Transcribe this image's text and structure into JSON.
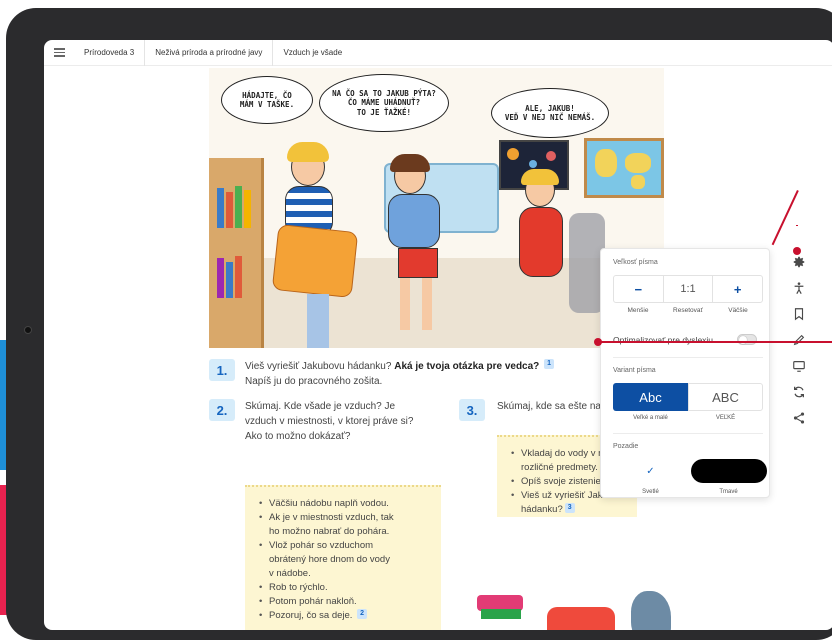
{
  "topbar": {
    "breadcrumbs": [
      "Prírodoveda 3",
      "Neživá príroda a prírodné javy",
      "Vzduch je všade"
    ]
  },
  "illustration": {
    "bubble_1": "HÁDAJTE, ČO\nMÁM V TAŠKE.",
    "bubble_2": "NA ČO SA TO JAKUB PÝTA?\nČO MÁME UHÁDNUŤ?\nTO JE ŤAŽKÉ!",
    "bubble_3": "ALE, JAKUB!\nVEĎ V NEJ NIČ NEMÁŠ."
  },
  "tasks": {
    "t1": {
      "number": "1.",
      "text": "Vieš vyriešiť Jakubovu hádanku?",
      "bold": "Aká je tvoja otázka pre vedca?",
      "ref": "1",
      "line2": "Napíš ju do pracovného zošita."
    },
    "t2": {
      "number": "2.",
      "line1": "Skúmaj. Kde všade je vzduch? Je",
      "line2": "vzduch v miestnosti, v ktorej práve si?",
      "line3": "Ako to možno dokázať?",
      "bullets": [
        "Väčšiu nádobu naplň vodou.",
        "Ak je v miestnosti vzduch, tak",
        "ho možno nabrať do pohára.",
        "Vlož pohár so vzduchom",
        "obrátený hore dnom do vody",
        "v nádobe.",
        "Rob to rýchlo.",
        "Potom pohár nakloň.",
        "Pozoruj, čo sa deje."
      ],
      "ref": "2"
    },
    "t3": {
      "number": "3.",
      "line1": "Skúmaj, kde sa ešte nachá",
      "bullets": [
        "Vkladaj do vody v nád",
        "rozličné predmety.",
        "Opíš svoje zistenie.",
        "Vieš už vyriešiť Jakub",
        "hádanku?"
      ],
      "ref": "3"
    }
  },
  "panel": {
    "size_label": "Veľkosť písma",
    "minus": "−",
    "reset": "1:1",
    "plus": "+",
    "minus_sub": "Menšie",
    "reset_sub": "Resetovať",
    "plus_sub": "Väčšie",
    "dyslexia": "Optimalizovať pre dyslexiu",
    "variant_label": "Variant písma",
    "variant_lower": "Abc",
    "variant_upper": "ABC",
    "variant_lower_sub": "Veľké a malé",
    "variant_upper_sub": "VEĽKÉ",
    "background_label": "Pozadie",
    "light_check": "✓",
    "light_sub": "Svetlé",
    "dark_sub": "Tmavé"
  },
  "toolbar": {
    "icons": [
      "gear-icon",
      "accessibility-icon",
      "bookmark-icon",
      "pencil-icon",
      "screen-icon",
      "sync-icon",
      "share-icon"
    ]
  },
  "colors": {
    "accent": "#0d4fa3",
    "number_bg": "#d6ecfa",
    "note_bg": "#fdf6d2",
    "frame": "#2b2b2d",
    "annotation": "#c8102e"
  }
}
